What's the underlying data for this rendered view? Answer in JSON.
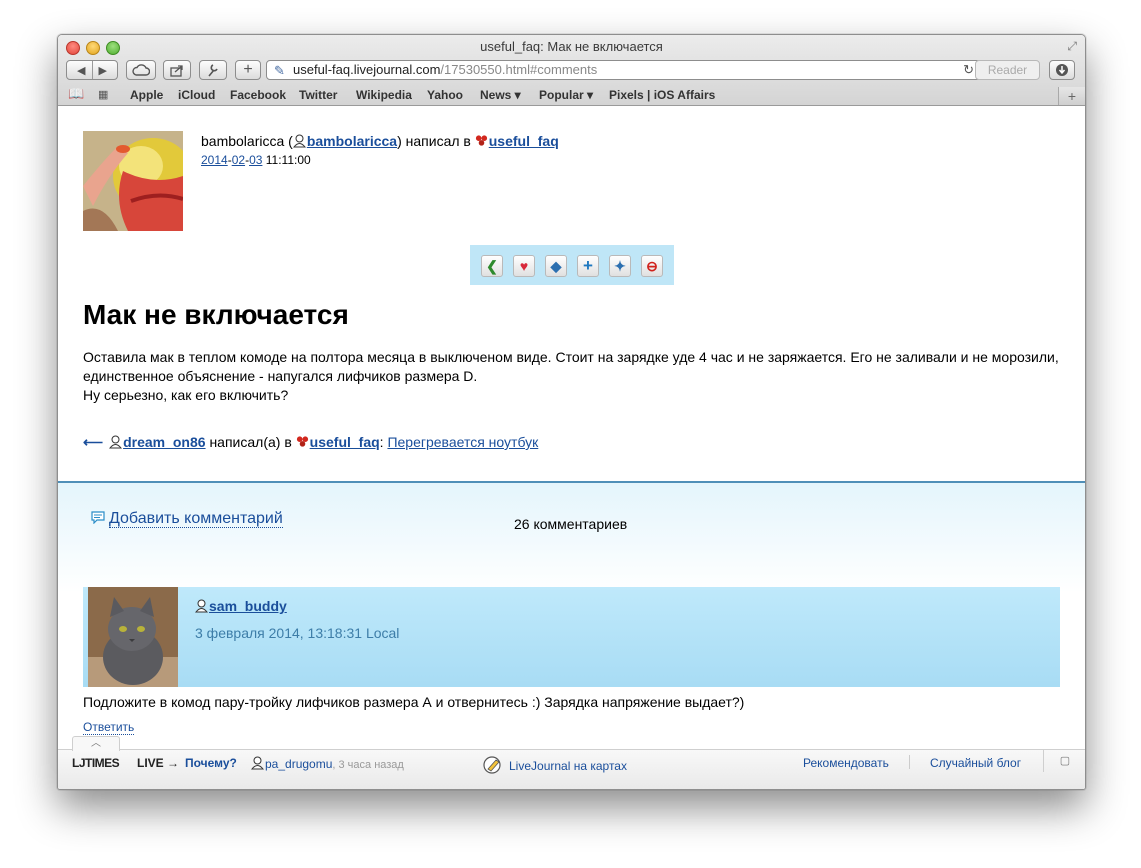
{
  "browser": {
    "window_title": "useful_faq: Мак не включается",
    "url_host": "useful-faq.livejournal.com",
    "url_path": "/17530550.html#comments",
    "reader_label": "Reader",
    "bookmarks": [
      "Apple",
      "iCloud",
      "Facebook",
      "Twitter",
      "Wikipedia",
      "Yahoo",
      "News ▾",
      "Popular ▾",
      "Pixels | iOS Affairs"
    ]
  },
  "entry": {
    "poster_name": "bambolaricca (",
    "poster_user": "bambolaricca",
    "wrote_in": ") написал в ",
    "community": "useful_faq",
    "date_year": "2014",
    "date_month": "02",
    "date_day": "03",
    "time": "11:11:00",
    "title": "Мак не включается",
    "body_line1": "Оставила мак в теплом комоде на полтора месяца в выключеном виде. Стоит на зарядке уде 4 час и не заряжается. Его не заливали и не морозили, единственное объяснение - напугался лифчиков размера D.",
    "body_line2": "Ну серьезно, как его включить?"
  },
  "prev_entry": {
    "user": "dream_on86",
    "wrote": " написал(а) в ",
    "community": "useful_faq",
    "colon": ":",
    "title": "Перегревается ноутбук"
  },
  "comments": {
    "add_label": "Добавить комментарий",
    "count_label": "26 комментариев",
    "items": [
      {
        "user": "sam_buddy",
        "date": "3 февраля 2014, 13:18:31 Local",
        "text": "Подложите в комод пару-тройку лифчиков размера А и отвернитесь :) Зарядка напряжение выдает?)",
        "reply_label": "Ответить"
      }
    ]
  },
  "bottom_bar": {
    "ljtimes": "LJTIMES",
    "live": "LIVE →",
    "why": "Почему?",
    "user": "pa_drugomu",
    "ago": ", 3 часа назад",
    "map": "LiveJournal на картах",
    "recommend": "Рекомендовать",
    "random": "Случайный блог"
  },
  "colors": {
    "link": "#1a4e9b",
    "comment_header_bg": "#bfe9fb",
    "actions_bg": "#bfe6f7"
  }
}
